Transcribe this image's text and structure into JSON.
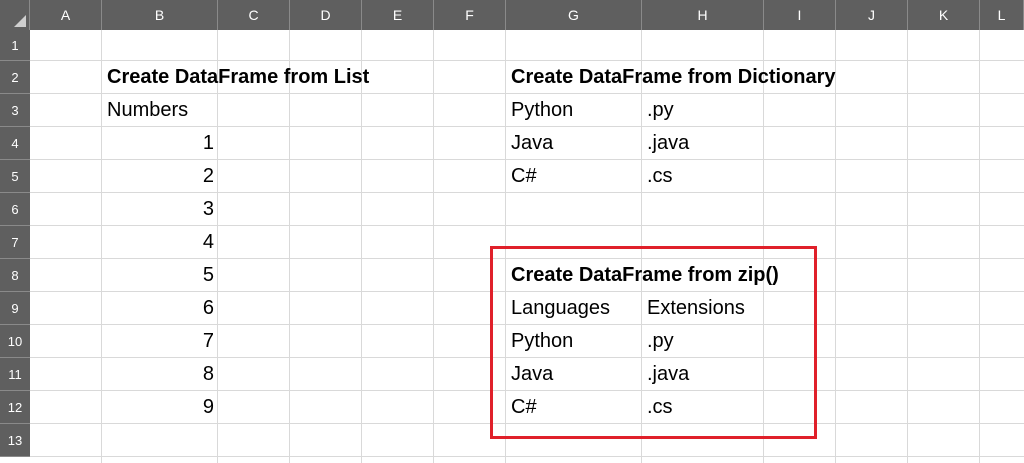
{
  "columns": [
    "A",
    "B",
    "C",
    "D",
    "E",
    "F",
    "G",
    "H",
    "I",
    "J",
    "K",
    "L"
  ],
  "rows": [
    "1",
    "2",
    "3",
    "4",
    "5",
    "6",
    "7",
    "8",
    "9",
    "10",
    "11",
    "12",
    "13"
  ],
  "colors": {
    "header_bg": "#5f5f5f",
    "grid": "#d9d9d9",
    "highlight": "#e0202a"
  },
  "cells": {
    "B2": "Create DataFrame from List",
    "B3": "Numbers",
    "B4": "1",
    "B5": "2",
    "B6": "3",
    "B7": "4",
    "B8": "5",
    "B9": "6",
    "B10": "7",
    "B11": "8",
    "B12": "9",
    "G2": "Create DataFrame from Dictionary",
    "G3": "Python",
    "H3": ".py",
    "G4": "Java",
    "H4": ".java",
    "G5": "C#",
    "H5": ".cs",
    "G8": "Create DataFrame from zip()",
    "G9": "Languages",
    "H9": "Extensions",
    "G10": "Python",
    "H10": ".py",
    "G11": "Java",
    "H11": ".java",
    "G12": "C#",
    "H12": ".cs"
  }
}
